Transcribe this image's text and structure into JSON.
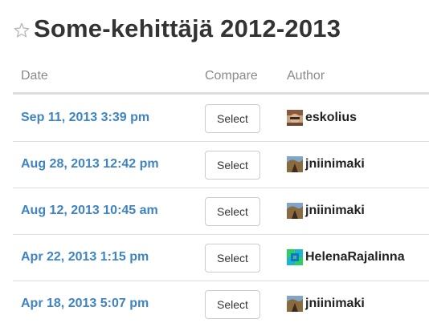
{
  "page": {
    "title": "Some-kehittäjä 2012-2013",
    "star_icon": "star-outline-icon"
  },
  "table": {
    "columns": {
      "date": "Date",
      "compare": "Compare",
      "author": "Author"
    },
    "rows": [
      {
        "date": "Sep 11, 2013 3:39 pm",
        "button": "Select",
        "author": "eskolius",
        "avatar": "avatar-eskolius"
      },
      {
        "date": "Aug 28, 2013 12:42 pm",
        "button": "Select",
        "author": "jniinimaki",
        "avatar": "avatar-jniinimaki"
      },
      {
        "date": "Aug 12, 2013 10:45 am",
        "button": "Select",
        "author": "jniinimaki",
        "avatar": "avatar-jniinimaki"
      },
      {
        "date": "Apr 22, 2013 1:15 pm",
        "button": "Select",
        "author": "HelenaRajalinna",
        "avatar": "avatar-helenarajalinna"
      },
      {
        "date": "Apr 18, 2013 5:07 pm",
        "button": "Select",
        "author": "jniinimaki",
        "avatar": "avatar-jniinimaki"
      }
    ]
  },
  "colors": {
    "link": "#3f84c2",
    "title": "#333333",
    "header_text": "#8a8a8a",
    "border": "#dddddd"
  }
}
